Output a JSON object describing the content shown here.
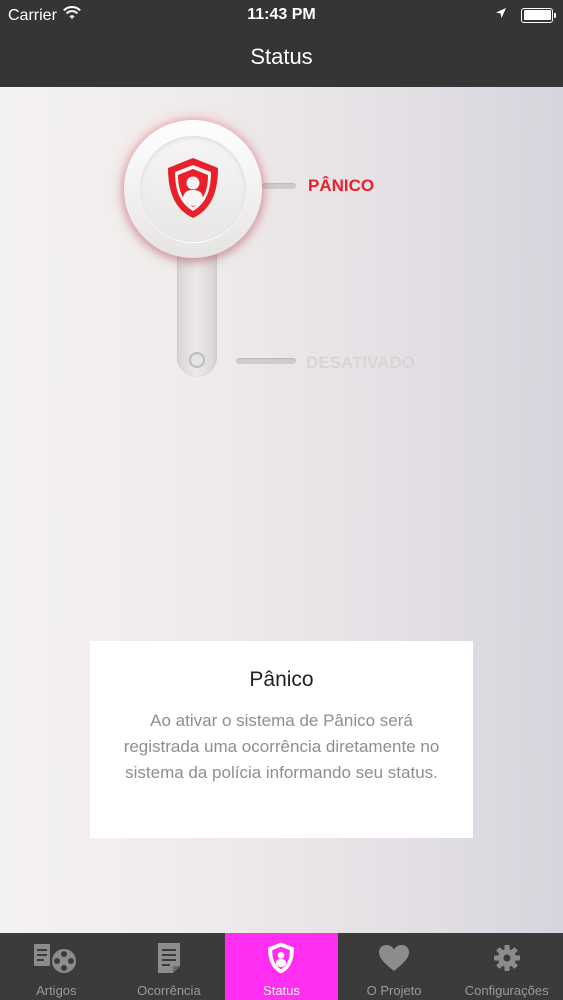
{
  "status_bar": {
    "carrier": "Carrier",
    "time": "11:43 PM"
  },
  "header": {
    "title": "Status"
  },
  "switch": {
    "panic_label": "PÂNICO",
    "off_label": "DESATIVADO",
    "active_position": "panic",
    "active_color": "#e8202a",
    "inactive_color": "#d8d5d5"
  },
  "info_card": {
    "title": "Pânico",
    "text": "Ao ativar o sistema de Pânico será registrada uma ocorrência diretamente no sistema da polícia informando seu status."
  },
  "tabbar": {
    "active_color": "#ff2ef0",
    "items": [
      {
        "label": "Artigos",
        "icon": "articles-film-icon",
        "active": false
      },
      {
        "label": "Ocorrência",
        "icon": "document-icon",
        "active": false
      },
      {
        "label": "Status",
        "icon": "shield-person-icon",
        "active": true
      },
      {
        "label": "O Projeto",
        "icon": "heart-icon",
        "active": false
      },
      {
        "label": "Configurações",
        "icon": "gear-icon",
        "active": false
      }
    ]
  }
}
